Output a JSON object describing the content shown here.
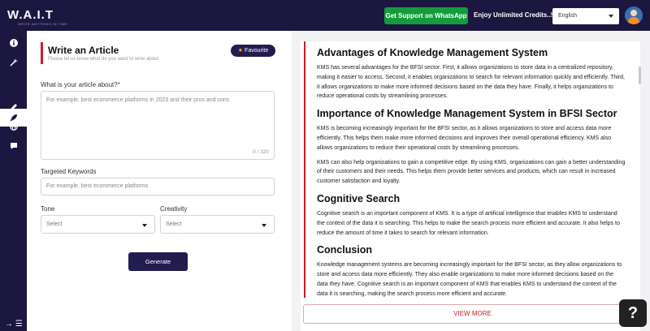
{
  "header": {
    "logo": "W.A.I.T",
    "logo_sub": "WRITE ANYTHING IN TIME",
    "whatsapp_label": "Get Support on WhatsApp",
    "credits_label": "Enjoy Unlimited Credits..!!",
    "language_value": "English"
  },
  "sidebar": {
    "icons": [
      "info-icon",
      "magic-icon",
      "rocket-icon",
      "pen-icon",
      "globe-icon",
      "chat-icon"
    ],
    "bottom_glyph": "→ ☰"
  },
  "form": {
    "title": "Write an Article",
    "subtitle": "Please let us know what do you want to write about",
    "favourite_label": "Favourite",
    "about_label": "What is your article about?",
    "about_required": "*",
    "about_placeholder": "For example, best ecommerce platforms in 2023 and their pros and cons",
    "char_count": "0 / 320",
    "keywords_label": "Targeted Keywords",
    "keywords_placeholder": "For example, best ecommerce platforms",
    "tone_label": "Tone",
    "tone_value": "Select",
    "creativity_label": "Creativity",
    "creativity_value": "Select",
    "generate_label": "Generate"
  },
  "article": {
    "sections": [
      {
        "heading": "Advantages of Knowledge Management System",
        "paragraphs": [
          "KMS has several advantages for the BFSI sector. First, it allows organizations to store data in a centralized repository, making it easier to access. Second, it enables organizations to search for relevant information quickly and efficiently. Third, it allows organizations to make more informed decisions based on the data they have. Finally, it helps organizations to reduce operational costs by streamlining processes."
        ]
      },
      {
        "heading": "Importance of Knowledge Management System in BFSI Sector",
        "paragraphs": [
          "KMS is becoming increasingly important for the BFSI sector, as it allows organizations to store and access data more efficiently. This helps them make more informed decisions and improves their overall operational efficiency. KMS also allows organizations to reduce their operational costs by streamlining processes.",
          "KMS can also help organizations to gain a competitive edge. By using KMS, organizations can gain a better understanding of their customers and their needs. This helps them provide better services and products, which can result in increased customer satisfaction and loyalty."
        ]
      },
      {
        "heading": "Cognitive Search",
        "paragraphs": [
          "Cognitive search is an important component of KMS. It is a type of artificial intelligence that enables KMS to understand the context of the data it is searching. This helps to make the search process more efficient and accurate. It also helps to reduce the amount of time it takes to search for relevant information."
        ]
      },
      {
        "heading": "Conclusion",
        "paragraphs": [
          "Knowledge management systems are becoming increasingly important for the BFSI sector, as they allow organizations to store and access data more efficiently. They also enable organizations to make more informed decisions based on the data they have. Cognitive search is an important component of KMS that enables KMS to understand the context of the data it is searching, making the search process more efficient and accurate."
        ]
      }
    ],
    "view_more_label": "VIEW MORE"
  },
  "help_label": "?",
  "colors": {
    "brand_dark": "#1c1740",
    "button_dark": "#231c4f",
    "accent_red": "#c81d25",
    "whatsapp_green": "#149c3c"
  }
}
